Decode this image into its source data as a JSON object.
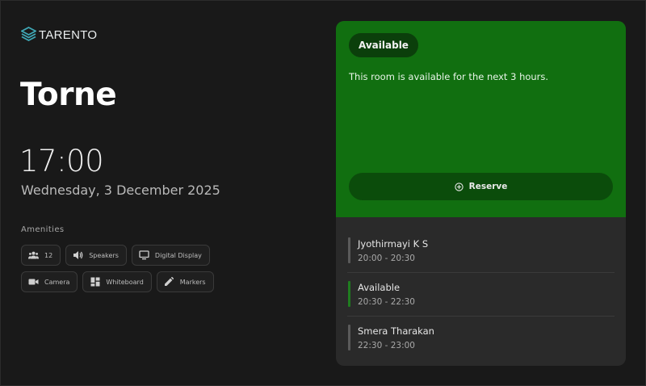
{
  "brand": {
    "name": "TARENTO",
    "logo_icon": "stacked-layers-logo",
    "logo_color": "#3fa7b5"
  },
  "room": {
    "name": "Torne"
  },
  "clock": {
    "time": "17:00",
    "date": "Wednesday, 3 December 2025"
  },
  "amenities": {
    "title": "Amenities",
    "items": [
      {
        "icon": "people-icon",
        "label": "12"
      },
      {
        "icon": "speaker-icon",
        "label": "Speakers"
      },
      {
        "icon": "monitor-icon",
        "label": "Digital Display"
      },
      {
        "icon": "camera-icon",
        "label": "Camera"
      },
      {
        "icon": "whiteboard-icon",
        "label": "Whiteboard"
      },
      {
        "icon": "marker-icon",
        "label": "Markers"
      }
    ]
  },
  "status": {
    "badge": "Available",
    "message": "This room is available for the next 3 hours.",
    "reserve_label": "Reserve",
    "reserve_icon": "plus-circle-icon",
    "color": "#116f10"
  },
  "schedule": [
    {
      "title": "Jyothirmayi K S",
      "time": "20:00 - 20:30",
      "state": "booked"
    },
    {
      "title": "Available",
      "time": "20:30 - 22:30",
      "state": "free"
    },
    {
      "title": "Smera Tharakan",
      "time": "22:30 - 23:00",
      "state": "booked"
    }
  ]
}
